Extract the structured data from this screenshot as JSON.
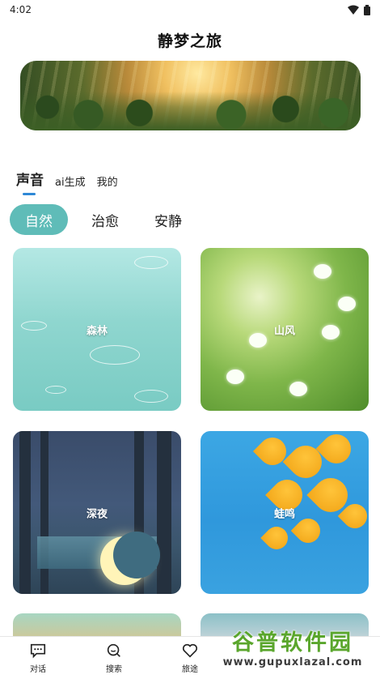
{
  "status_bar": {
    "time": "4:02"
  },
  "app": {
    "title": "静梦之旅"
  },
  "tabs": [
    "声音",
    "ai生成",
    "我的"
  ],
  "chips": [
    "自然",
    "治愈",
    "安静"
  ],
  "cards": [
    "森林",
    "山风",
    "深夜",
    "蛙鸣"
  ],
  "bottom_nav": [
    "对话",
    "搜索",
    "旅途"
  ],
  "watermark": {
    "title": "谷普软件园",
    "url": "www.gupuxlazal.com"
  },
  "colors": {
    "accent": "#5fbcb8",
    "tab_underline": "#2e88d6",
    "watermark_green": "#5aa62c"
  }
}
